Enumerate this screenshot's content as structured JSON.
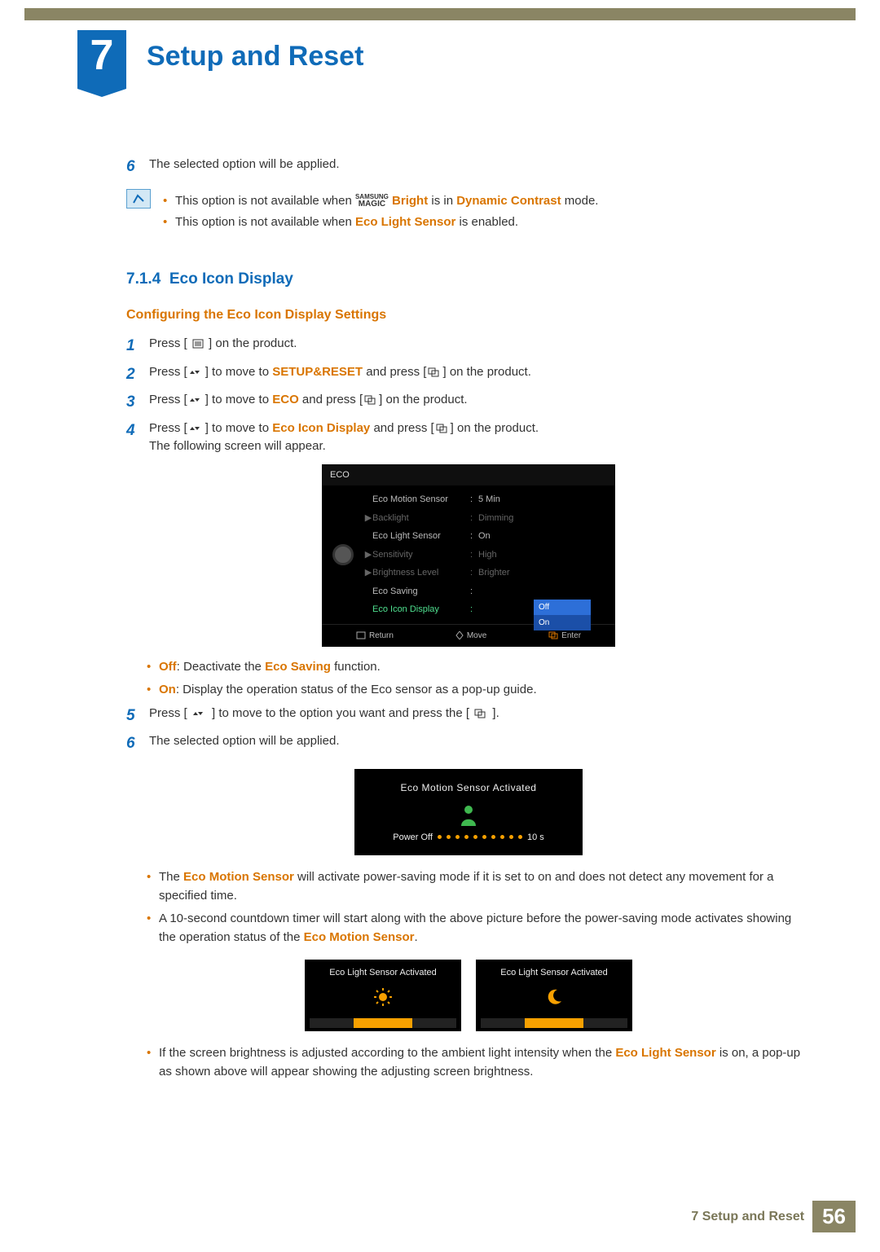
{
  "chapter": {
    "number": "7",
    "title": "Setup and Reset"
  },
  "step_top": {
    "num": "6",
    "text": "The selected option will be applied."
  },
  "top_notes": [
    {
      "pre": "This option is not available when ",
      "magic_top": "SAMSUNG",
      "magic_bot": "MAGIC",
      "magic_label": "Bright",
      "mid": " is in ",
      "bold": "Dynamic Contrast",
      "post": " mode."
    },
    {
      "pre": "This option is not available when ",
      "bold": "Eco Light Sensor",
      "post": " is enabled."
    }
  ],
  "section": {
    "number": "7.1.4",
    "title": "Eco Icon Display"
  },
  "subheading": "Configuring the Eco Icon Display Settings",
  "steps": [
    {
      "n": "1",
      "pre": "Press [ ",
      "icon": "menu",
      "post": " ] on the product."
    },
    {
      "n": "2",
      "pre": "Press [",
      "icon": "updown",
      "mid": "] to move to ",
      "bold": "SETUP&RESET",
      "mid2": " and press [",
      "icon2": "enter",
      "post": "] on the product."
    },
    {
      "n": "3",
      "pre": "Press [",
      "icon": "updown",
      "mid": "] to move to ",
      "bold": "ECO",
      "mid2": " and press [",
      "icon2": "enter",
      "post": "] on the product."
    },
    {
      "n": "4",
      "pre": "Press [",
      "icon": "updown",
      "mid": "] to move to ",
      "bold": "Eco Icon Display",
      "mid2": " and press [",
      "icon2": "enter",
      "post": "] on the product.",
      "line2": "The following screen will appear."
    }
  ],
  "osd": {
    "title": "ECO",
    "rows": [
      {
        "arrow": "",
        "label": "Eco Motion Sensor",
        "value": "5 Min",
        "dim": false
      },
      {
        "arrow": "▶",
        "label": "Backlight",
        "value": "Dimming",
        "dim": true
      },
      {
        "arrow": "",
        "label": "Eco Light Sensor",
        "value": "On",
        "dim": false
      },
      {
        "arrow": "▶",
        "label": "Sensitivity",
        "value": "High",
        "dim": true
      },
      {
        "arrow": "▶",
        "label": "Brightness Level",
        "value": "Brighter",
        "dim": true
      },
      {
        "arrow": "",
        "label": "Eco Saving",
        "value": "",
        "dim": false
      },
      {
        "arrow": "",
        "label": "Eco Icon Display",
        "value": "",
        "dim": false,
        "selected": true
      }
    ],
    "popup": [
      "Off",
      "On"
    ],
    "footer": {
      "return": "Return",
      "move": "Move",
      "enter": "Enter"
    }
  },
  "off_on": [
    {
      "key": "Off",
      "text": ": Deactivate the ",
      "bold": "Eco Saving",
      "post": " function."
    },
    {
      "key": "On",
      "text": ": Display the operation status of the Eco sensor as a pop-up guide."
    }
  ],
  "step5": {
    "n": "5",
    "pre": "Press [",
    "icon": "updown",
    "mid": "] to move to the option you want and press the [",
    "icon2": "enter",
    "post": "]."
  },
  "step6": {
    "n": "6",
    "text": "The selected option will be applied."
  },
  "motion_popup": {
    "title": "Eco Motion Sensor Activated",
    "left": "Power Off",
    "right": "10 s",
    "dots": 10
  },
  "motion_notes": [
    {
      "pre": "The ",
      "bold": "Eco Motion Sensor",
      "post": " will activate power-saving mode if it is set to on and does not detect any movement for a specified time."
    },
    {
      "pre": "A 10-second countdown timer will start along with the above picture before the power-saving mode activates showing the operation status of the ",
      "bold": "Eco Motion Sensor",
      "post": "."
    }
  ],
  "light_boxes": [
    {
      "title": "Eco Light Sensor Activated",
      "icon": "sun"
    },
    {
      "title": "Eco Light Sensor Activated",
      "icon": "moon"
    }
  ],
  "light_note": {
    "pre": "If the screen brightness is adjusted according to the ambient light intensity when the ",
    "bold": "Eco Light Sensor",
    "post": " is on, a pop-up as shown above will appear showing the adjusting screen brightness."
  },
  "footer": {
    "category": "7 Setup and Reset",
    "page": "56"
  }
}
